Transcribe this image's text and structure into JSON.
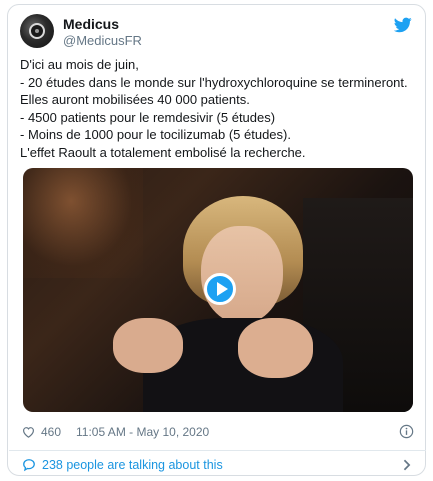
{
  "account": {
    "name": "Medicus",
    "handle": "@MedicusFR"
  },
  "tweet": {
    "lines": [
      "D'ici au mois de juin,",
      "- 20 études dans le monde sur l'hydroxychloroquine se termineront.",
      "Elles auront mobilisées 40 000 patients.",
      "- 4500 patients pour le remdesivir (5 études)",
      "- Moins de 1000 pour le tocilizumab (5 études).",
      "L'effet Raoult a totalement embolisé la recherche."
    ]
  },
  "meta": {
    "likes": "460",
    "timestamp": "11:05 AM - May 10, 2020"
  },
  "footer": {
    "talking": "238 people are talking about this"
  },
  "colors": {
    "accent": "#1da1f2",
    "link": "#1b95e0",
    "secondary_text": "#657786"
  },
  "icons": {
    "brand": "twitter-bird-icon",
    "like": "heart-icon",
    "info": "info-icon",
    "comments": "comment-bubble-icon",
    "more": "chevron-right-icon",
    "media": "play-icon"
  }
}
